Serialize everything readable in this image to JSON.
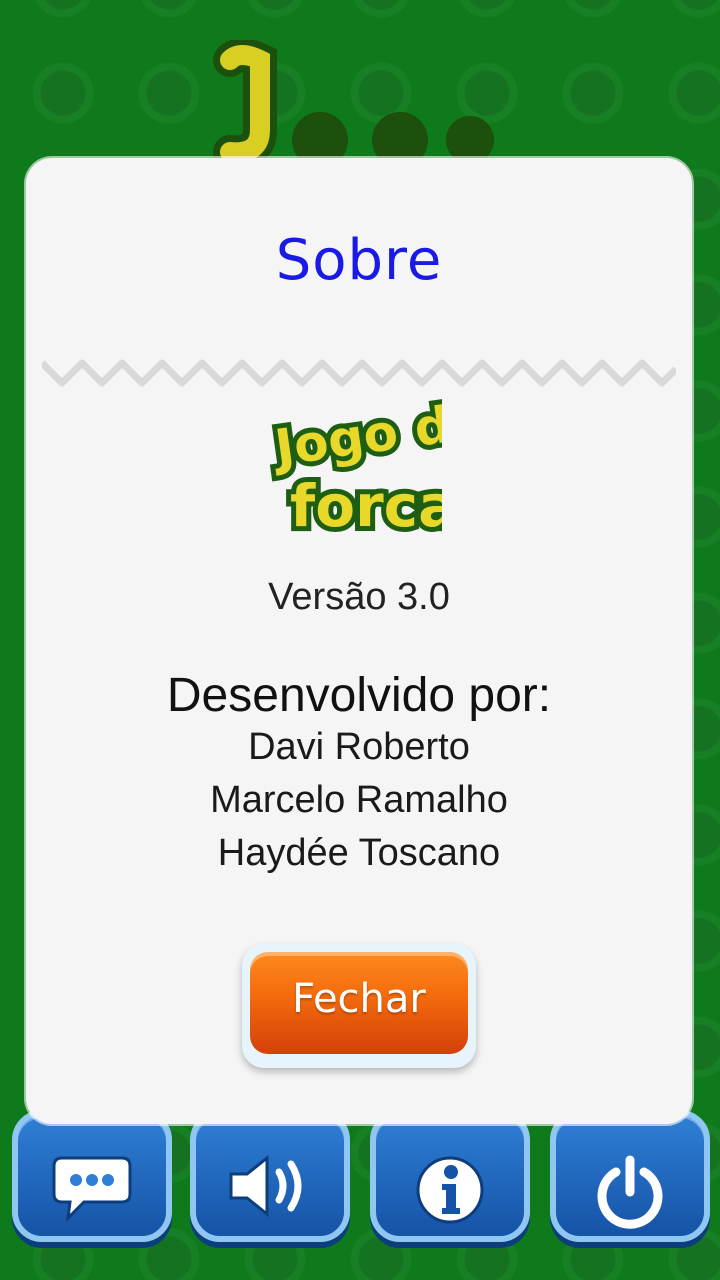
{
  "dialog": {
    "title": "Sobre",
    "logo_text_line1": "Jogo da",
    "logo_text_line2": "forca",
    "version": "Versão 3.0",
    "developers_heading": "Desenvolvido por:",
    "developers": [
      "Davi Roberto",
      "Marcelo Ramalho",
      "Haydée Toscano"
    ],
    "close_label": "Fechar"
  },
  "bottom_bar": {
    "buttons": [
      {
        "icon": "chat-bubble-icon"
      },
      {
        "icon": "speaker-icon"
      },
      {
        "icon": "info-icon"
      },
      {
        "icon": "power-icon"
      }
    ]
  },
  "colors": {
    "background_green": "#0e7a1b",
    "title_blue": "#1a1ae6",
    "button_orange": "#f26a0c",
    "tile_blue": "#1e63b8",
    "logo_yellow": "#e8d82a",
    "logo_green": "#1d5e12"
  }
}
